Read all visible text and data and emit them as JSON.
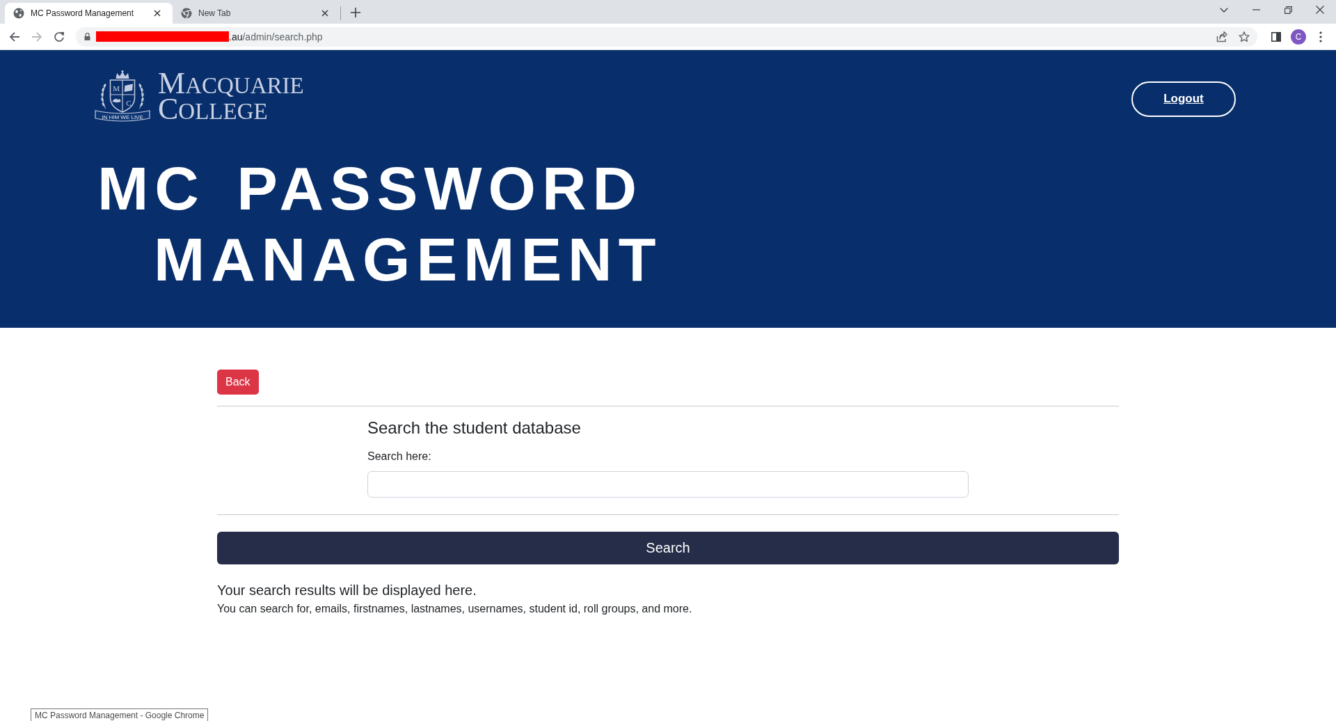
{
  "browser": {
    "tabs": [
      {
        "title": "MC Password Management",
        "selected": true,
        "kind": "globe"
      },
      {
        "title": "New Tab",
        "selected": false,
        "kind": "chrome"
      }
    ],
    "navigation": {
      "back": {
        "disabled": false
      },
      "forward": {
        "disabled": true
      }
    },
    "address_bar": {
      "redacted": true,
      "host_visible": ".au",
      "path": "/admin/search.php"
    },
    "profile": {
      "initial": "C"
    }
  },
  "header": {
    "logo": {
      "crest_letters": [
        "M",
        "C"
      ],
      "motto": "IN HIM WE LIVE",
      "lines": [
        "MACQUARIE",
        "COLLEGE"
      ]
    },
    "logout_button": "Logout",
    "title": "MC PASSWORD MANAGEMENT"
  },
  "content": {
    "back_button": "Back",
    "form": {
      "heading": "Search the student database",
      "label": "Search here:"
    },
    "search_button": "Search",
    "results": {
      "message": "Your search results will be displayed here.",
      "hint": "You can search for, emails, firstnames, lastnames, usernames, student id, roll groups, and more."
    }
  },
  "taskbar_tooltip": "MC Password Management - Google Chrome"
}
